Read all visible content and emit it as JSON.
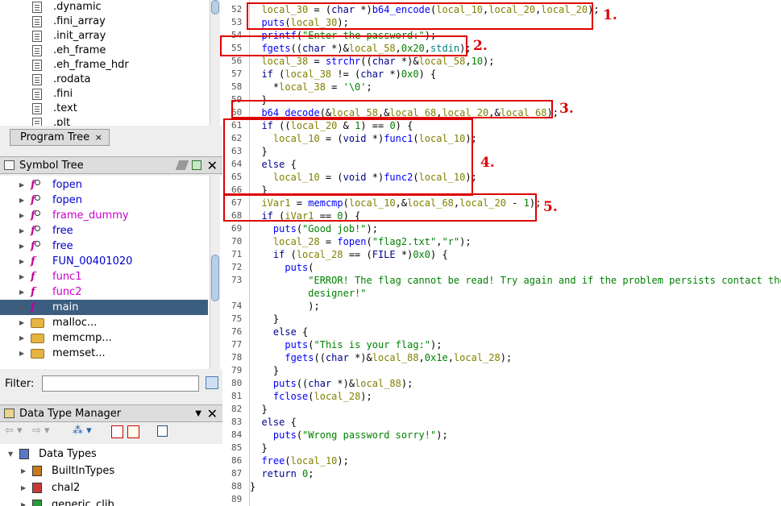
{
  "left": {
    "sections": [
      ".dynamic",
      ".fini_array",
      ".init_array",
      ".eh_frame",
      ".eh_frame_hdr",
      ".rodata",
      ".fini",
      ".text",
      ".plt"
    ],
    "program_tree_tab": "Program Tree",
    "tab_close": "×",
    "symbol_tree": {
      "title": "Symbol Tree",
      "items": [
        {
          "label": "fopen",
          "kind": "thunk",
          "color": "#0000cc"
        },
        {
          "label": "fopen",
          "kind": "thunk",
          "color": "#0000cc"
        },
        {
          "label": "frame_dummy",
          "kind": "thunk",
          "color": "#cc00cc"
        },
        {
          "label": "free",
          "kind": "thunk",
          "color": "#0000cc"
        },
        {
          "label": "free",
          "kind": "thunk",
          "color": "#0000cc"
        },
        {
          "label": "FUN_00401020",
          "kind": "func",
          "color": "#0000cc"
        },
        {
          "label": "func1",
          "kind": "func",
          "color": "#cc00cc"
        },
        {
          "label": "func2",
          "kind": "func",
          "color": "#cc00cc"
        },
        {
          "label": "main",
          "kind": "func",
          "color": "#ffffff",
          "selected": true
        },
        {
          "label": "malloc...",
          "kind": "folder",
          "color": "#000000"
        },
        {
          "label": "memcmp...",
          "kind": "folder",
          "color": "#000000"
        },
        {
          "label": "memset...",
          "kind": "folder",
          "color": "#000000"
        }
      ],
      "filter_label": "Filter:"
    },
    "data_type_manager": {
      "title": "Data Type Manager",
      "items": [
        {
          "label": "Data Types",
          "level": 0
        },
        {
          "label": "BuiltInTypes",
          "level": 1
        },
        {
          "label": "chal2",
          "level": 1
        },
        {
          "label": "generic_clib",
          "level": 1
        }
      ]
    },
    "close": "✕"
  },
  "code": {
    "lines": [
      {
        "n": "52",
        "html": "  <span class='vr'>local_30</span> = (<span class='ty'>char</span> *)<span class='fn'>b64_encode</span>(<span class='vr'>local_10</span>,<span class='vr'>local_20</span>,<span class='vr'>local_20</span>);"
      },
      {
        "n": "53",
        "html": "  <span class='fn'>puts</span>(<span class='vr'>local_30</span>);"
      },
      {
        "n": "54",
        "html": "  <span class='fn'>printf</span>(<span class='st'>\"Enter the password:\"</span>);"
      },
      {
        "n": "55",
        "html": "  <span class='fn'>fgets</span>((<span class='ty'>char</span> *)&amp;<span class='vr'>local_58</span>,<span class='nm'>0x20</span>,<span class='gl'>stdin</span>);"
      },
      {
        "n": "56",
        "html": "  <span class='vr'>local_38</span> = <span class='fn'>strchr</span>((<span class='ty'>char</span> *)&amp;<span class='vr'>local_58</span>,<span class='nm'>10</span>);"
      },
      {
        "n": "57",
        "html": "  <span class='kw'>if</span> (<span class='vr'>local_38</span> != (<span class='ty'>char</span> *)<span class='nm'>0x0</span>) {"
      },
      {
        "n": "58",
        "html": "    *<span class='vr'>local_38</span> = <span class='st'>'\\0'</span>;"
      },
      {
        "n": "59",
        "html": "  }"
      },
      {
        "n": "60",
        "html": "  <span class='fn'>b64_decode</span>(&amp;<span class='vr'>local_58</span>,&amp;<span class='vr'>local_68</span>,<span class='vr'>local_20</span>,&amp;<span class='vr'>local_68</span>);"
      },
      {
        "n": "61",
        "html": "  <span class='kw'>if</span> ((<span class='vr'>local_20</span> &amp; <span class='nm'>1</span>) == <span class='nm'>0</span>) {"
      },
      {
        "n": "62",
        "html": "    <span class='vr'>local_10</span> = (<span class='ty'>void</span> *)<span class='fn'>func1</span>(<span class='vr'>local_10</span>);"
      },
      {
        "n": "63",
        "html": "  }"
      },
      {
        "n": "64",
        "html": "  <span class='kw'>else</span> {"
      },
      {
        "n": "65",
        "html": "    <span class='vr'>local_10</span> = (<span class='ty'>void</span> *)<span class='fn'>func2</span>(<span class='vr'>local_10</span>);"
      },
      {
        "n": "66",
        "html": "  }"
      },
      {
        "n": "67",
        "html": "  <span class='vr'>iVar1</span> = <span class='fn'>memcmp</span>(<span class='vr'>local_10</span>,&amp;<span class='vr'>local_68</span>,<span class='vr'>local_20</span> - <span class='nm'>1</span>);"
      },
      {
        "n": "68",
        "html": "  <span class='kw'>if</span> (<span class='vr'>iVar1</span> == <span class='nm'>0</span>) {"
      },
      {
        "n": "69",
        "html": "    <span class='fn'>puts</span>(<span class='st'>\"Good job!\"</span>);"
      },
      {
        "n": "70",
        "html": "    <span class='vr'>local_28</span> = <span class='fn'>fopen</span>(<span class='st'>\"flag2.txt\"</span>,<span class='st'>\"r\"</span>);"
      },
      {
        "n": "71",
        "html": "    <span class='kw'>if</span> (<span class='vr'>local_28</span> == (<span class='ty'>FILE</span> *)<span class='nm'>0x0</span>) {"
      },
      {
        "n": "72",
        "html": "      <span class='fn'>puts</span>("
      },
      {
        "n": "73",
        "html": "          <span class='st'>\"ERROR! The flag cannot be read! Try again and if the problem persists contact the</span>"
      },
      {
        "n": "",
        "html": "          <span class='st'>designer!\"</span>"
      },
      {
        "n": "74",
        "html": "          );"
      },
      {
        "n": "75",
        "html": "    }"
      },
      {
        "n": "76",
        "html": "    <span class='kw'>else</span> {"
      },
      {
        "n": "77",
        "html": "      <span class='fn'>puts</span>(<span class='st'>\"This is your flag:\"</span>);"
      },
      {
        "n": "78",
        "html": "      <span class='fn'>fgets</span>((<span class='ty'>char</span> *)&amp;<span class='vr'>local_88</span>,<span class='nm'>0x1e</span>,<span class='vr'>local_28</span>);"
      },
      {
        "n": "79",
        "html": "    }"
      },
      {
        "n": "80",
        "html": "    <span class='fn'>puts</span>((<span class='ty'>char</span> *)&amp;<span class='vr'>local_88</span>);"
      },
      {
        "n": "81",
        "html": "    <span class='fn'>fclose</span>(<span class='vr'>local_28</span>);"
      },
      {
        "n": "82",
        "html": "  }"
      },
      {
        "n": "83",
        "html": "  <span class='kw'>else</span> {"
      },
      {
        "n": "84",
        "html": "    <span class='fn'>puts</span>(<span class='st'>\"Wrong password sorry!\"</span>);"
      },
      {
        "n": "85",
        "html": "  }"
      },
      {
        "n": "86",
        "html": "  <span class='fn'>free</span>(<span class='vr'>local_10</span>);"
      },
      {
        "n": "87",
        "html": "  <span class='kw'>return</span> <span class='nm'>0</span>;"
      },
      {
        "n": "88",
        "html": "}"
      },
      {
        "n": "89",
        "html": ""
      }
    ],
    "annotations": [
      "1.",
      "2.",
      "3.",
      "4.",
      "5."
    ]
  },
  "colors": {
    "annotation": "#dd0000",
    "selection": "#3b5e80"
  }
}
